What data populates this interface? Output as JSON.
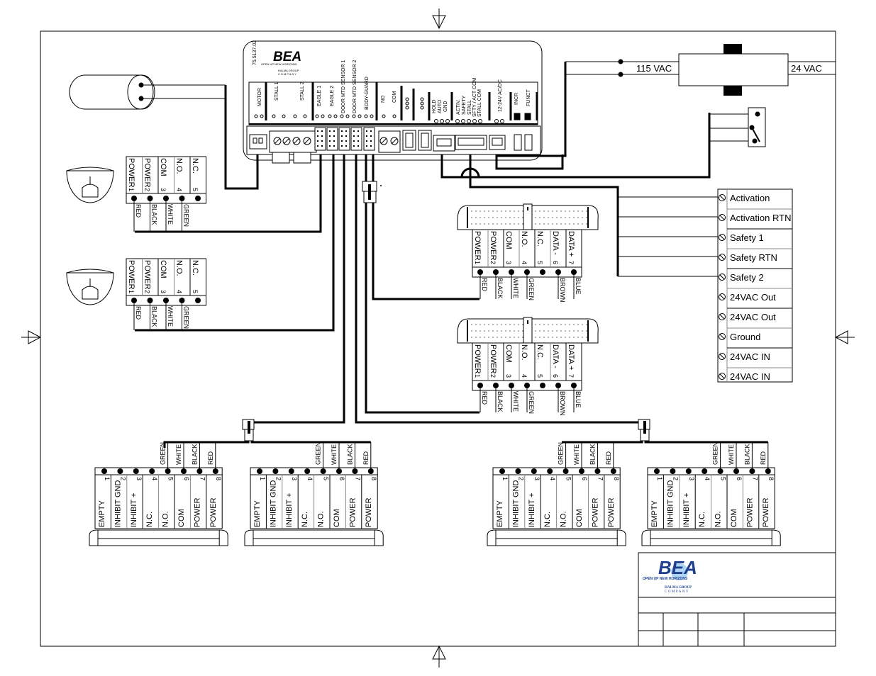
{
  "controller": {
    "part_number": "75.5137.02",
    "brand": "BEA",
    "tagline": "OPEN UP NEW HORIZONS",
    "group_line1": "HALMA GROUP",
    "group_line2": "COMPANY",
    "sections": [
      {
        "label": "MOTOR"
      },
      {
        "label": "STALL 1"
      },
      {
        "label": "STALL 2"
      },
      {
        "label": "EAGLE 1"
      },
      {
        "label": "EAGLE 2"
      },
      {
        "label": "DOOR MTD SENSOR 1"
      },
      {
        "label": "DOOR MTD SENSOR 2"
      },
      {
        "label": "BODY-GUARD"
      },
      {
        "label": "NO"
      },
      {
        "label": "COM"
      },
      {
        "label": "HOLD"
      },
      {
        "label": "AUTO"
      },
      {
        "label": "GND"
      },
      {
        "label": "ACTIV."
      },
      {
        "label": "SAFETY"
      },
      {
        "label": "STALL"
      },
      {
        "label": "SFTY / ACT COM"
      },
      {
        "label": "STALL COM"
      },
      {
        "label": "12-24V AC/DC"
      },
      {
        "label": "INCR"
      },
      {
        "label": "FUNCT"
      }
    ]
  },
  "transformer": {
    "input_label": "115 VAC",
    "output_label": "24  VAC"
  },
  "terminal_strip": {
    "items": [
      "Activation",
      "Activation RTN",
      "Safety 1",
      "Safety RTN",
      "Safety 2",
      "24VAC Out",
      "24VAC Out",
      "Ground",
      "24VAC IN",
      "24VAC IN"
    ]
  },
  "eagle_sensors": [
    {
      "pins": [
        {
          "label": "POWER",
          "num": "1",
          "wire": "RED"
        },
        {
          "label": "POWER",
          "num": "2",
          "wire": "BLACK"
        },
        {
          "label": "COM",
          "num": "3",
          "wire": "WHITE"
        },
        {
          "label": "N.O.",
          "num": "4",
          "wire": "GREEN"
        },
        {
          "label": "N.C.",
          "num": "5",
          "wire": ""
        }
      ]
    },
    {
      "pins": [
        {
          "label": "POWER",
          "num": "1",
          "wire": "RED"
        },
        {
          "label": "POWER",
          "num": "2",
          "wire": "BLACK"
        },
        {
          "label": "COM",
          "num": "3",
          "wire": "WHITE"
        },
        {
          "label": "N.O.",
          "num": "4",
          "wire": "GREEN"
        },
        {
          "label": "N.C.",
          "num": "5",
          "wire": ""
        }
      ]
    }
  ],
  "door_sensors": [
    {
      "pins": [
        {
          "label": "POWER",
          "num": "1",
          "wire": "RED"
        },
        {
          "label": "POWER",
          "num": "2",
          "wire": "BLACK"
        },
        {
          "label": "COM",
          "num": "3",
          "wire": "WHITE"
        },
        {
          "label": "N.O.",
          "num": "4",
          "wire": "GREEN"
        },
        {
          "label": "N.C.",
          "num": "5",
          "wire": ""
        },
        {
          "label": "DATA -",
          "num": "6",
          "wire": "BROWN"
        },
        {
          "label": "DATA +",
          "num": "7",
          "wire": "BLUE"
        }
      ]
    },
    {
      "pins": [
        {
          "label": "POWER",
          "num": "1",
          "wire": "RED"
        },
        {
          "label": "POWER",
          "num": "2",
          "wire": "BLACK"
        },
        {
          "label": "COM",
          "num": "3",
          "wire": "WHITE"
        },
        {
          "label": "N.O.",
          "num": "4",
          "wire": "GREEN"
        },
        {
          "label": "N.C.",
          "num": "5",
          "wire": ""
        },
        {
          "label": "DATA -",
          "num": "6",
          "wire": "BROWN"
        },
        {
          "label": "DATA +",
          "num": "7",
          "wire": "BLUE"
        }
      ]
    }
  ],
  "bodyguard_sensors": [
    {
      "pins": [
        {
          "label": "EMPTY",
          "num": "1",
          "wire": ""
        },
        {
          "label": "INHIBIT GND",
          "num": "2",
          "wire": ""
        },
        {
          "label": "INHIBIT +",
          "num": "3",
          "wire": ""
        },
        {
          "label": "N.C.",
          "num": "4",
          "wire": ""
        },
        {
          "label": "N.O.",
          "num": "5",
          "wire": "GREEN"
        },
        {
          "label": "COM",
          "num": "6",
          "wire": "WHITE"
        },
        {
          "label": "POWER",
          "num": "7",
          "wire": "BLACK"
        },
        {
          "label": "POWER",
          "num": "8",
          "wire": "RED"
        }
      ]
    },
    {
      "pins": [
        {
          "label": "EMPTY",
          "num": "1",
          "wire": ""
        },
        {
          "label": "INHIBIT GND",
          "num": "2",
          "wire": ""
        },
        {
          "label": "INHIBIT +",
          "num": "3",
          "wire": ""
        },
        {
          "label": "N.C.",
          "num": "4",
          "wire": ""
        },
        {
          "label": "N.O.",
          "num": "5",
          "wire": "GREEN"
        },
        {
          "label": "COM",
          "num": "6",
          "wire": "WHITE"
        },
        {
          "label": "POWER",
          "num": "7",
          "wire": "BLACK"
        },
        {
          "label": "POWER",
          "num": "8",
          "wire": "RED"
        }
      ]
    },
    {
      "pins": [
        {
          "label": "EMPTY",
          "num": "1",
          "wire": ""
        },
        {
          "label": "INHIBIT GND",
          "num": "2",
          "wire": ""
        },
        {
          "label": "INHIBIT +",
          "num": "3",
          "wire": ""
        },
        {
          "label": "N.C.",
          "num": "4",
          "wire": ""
        },
        {
          "label": "N.O.",
          "num": "5",
          "wire": "GREEN"
        },
        {
          "label": "COM",
          "num": "6",
          "wire": "WHITE"
        },
        {
          "label": "POWER",
          "num": "7",
          "wire": "BLACK"
        },
        {
          "label": "POWER",
          "num": "8",
          "wire": "RED"
        }
      ]
    },
    {
      "pins": [
        {
          "label": "EMPTY",
          "num": "1",
          "wire": ""
        },
        {
          "label": "INHIBIT GND",
          "num": "2",
          "wire": ""
        },
        {
          "label": "INHIBIT +",
          "num": "3",
          "wire": ""
        },
        {
          "label": "N.C.",
          "num": "4",
          "wire": ""
        },
        {
          "label": "N.O.",
          "num": "5",
          "wire": "GREEN"
        },
        {
          "label": "COM",
          "num": "6",
          "wire": "WHITE"
        },
        {
          "label": "POWER",
          "num": "7",
          "wire": "BLACK"
        },
        {
          "label": "POWER",
          "num": "8",
          "wire": "RED"
        }
      ]
    }
  ],
  "title_block": {
    "brand": "BEA",
    "tagline": "OPEN UP NEW HORIZONS",
    "group_line1": "HALMA GROUP",
    "group_line2": "COMPANY",
    "brand_color": "#1f3f8f",
    "accent_color": "#3a8fd8"
  }
}
